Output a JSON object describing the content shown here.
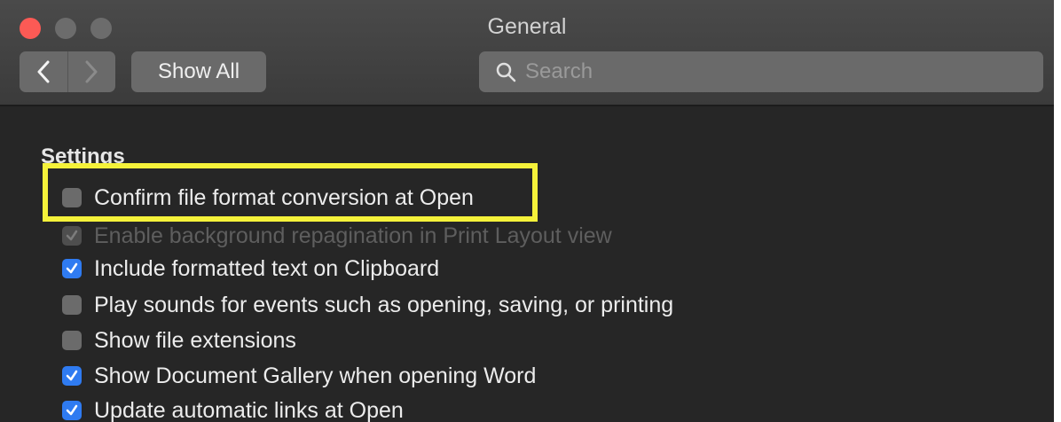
{
  "window": {
    "title": "General"
  },
  "toolbar": {
    "back_icon": "chevron-left-icon",
    "forward_icon": "chevron-right-icon",
    "show_all_label": "Show All",
    "search_placeholder": "Search",
    "search_value": ""
  },
  "settings": {
    "heading": "Settings",
    "options": [
      {
        "label": "Confirm file format conversion at Open",
        "checked": false,
        "enabled": true,
        "highlighted": true
      },
      {
        "label": "Enable background repagination in Print Layout view",
        "checked": true,
        "enabled": false,
        "highlighted": false
      },
      {
        "label": "Include formatted text on Clipboard",
        "checked": true,
        "enabled": true,
        "highlighted": false
      },
      {
        "label": "Play sounds for events such as opening, saving, or printing",
        "checked": false,
        "enabled": true,
        "highlighted": false
      },
      {
        "label": "Show file extensions",
        "checked": false,
        "enabled": true,
        "highlighted": false
      },
      {
        "label": "Show Document Gallery when opening Word",
        "checked": true,
        "enabled": true,
        "highlighted": false
      },
      {
        "label": "Update automatic links at Open",
        "checked": true,
        "enabled": true,
        "highlighted": false
      }
    ]
  },
  "colors": {
    "checkbox_checked": "#2f7bf1",
    "highlight_box": "#f5f23a",
    "close_button": "#fc5a55"
  }
}
